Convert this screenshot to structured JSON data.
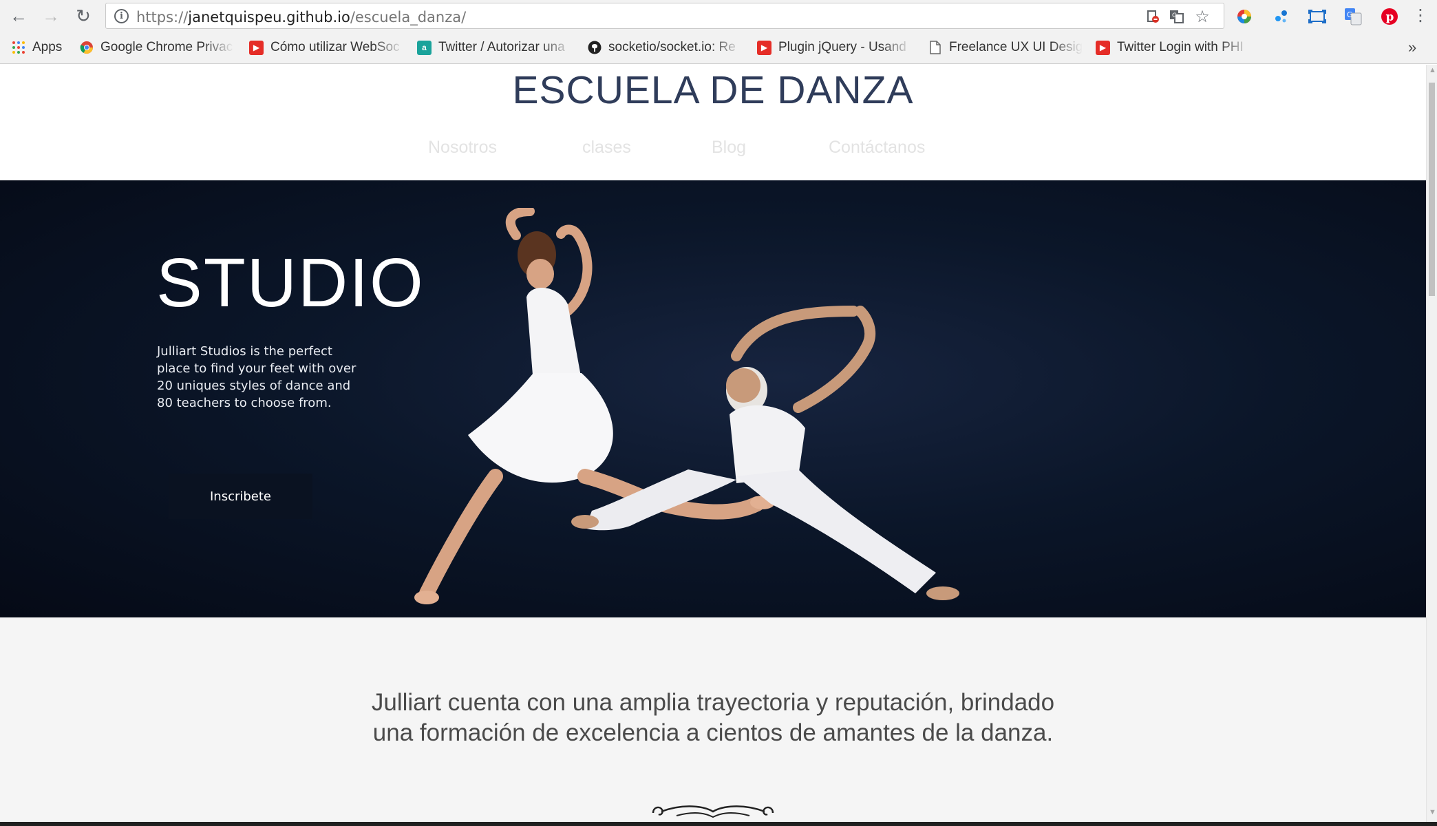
{
  "browser": {
    "url_scheme": "https://",
    "url_host": "janetquispeu.github.io",
    "url_path": "/escuela_danza/",
    "bookmarks": [
      {
        "label": "Apps",
        "icon": "apps-grid-icon"
      },
      {
        "label": "Google Chrome Privac",
        "icon": "chrome-icon"
      },
      {
        "label": "Cómo utilizar WebSoc",
        "icon": "youtube-icon"
      },
      {
        "label": "Twitter / Autorizar una",
        "icon": "page-icon"
      },
      {
        "label": "socketio/socket.io: Re",
        "icon": "github-icon"
      },
      {
        "label": "Plugin jQuery - Usand",
        "icon": "youtube-icon"
      },
      {
        "label": "Freelance UX UI Desig",
        "icon": "document-icon"
      },
      {
        "label": "Twitter Login with PHI",
        "icon": "youtube-icon"
      }
    ],
    "overflow_label": "»"
  },
  "site": {
    "title": "ESCUELA DE DANZA",
    "nav": [
      "Nosotros",
      "clases",
      "Blog",
      "Contáctanos"
    ]
  },
  "hero": {
    "title": "STUDIO",
    "description": "Julliart Studios is the perfect place to find your feet with over 20 uniques styles of dance and 80 teachers to choose from.",
    "button": "Inscribete"
  },
  "about": {
    "line1": "Julliart cuenta con una amplia trayectoria y reputación, brindado",
    "line2": "una formación de excelencia a cientos de amantes de la danza."
  },
  "colors": {
    "title": "#2f3c5a",
    "hero_bg": "#0b1629",
    "youtube_red": "#e52d27"
  }
}
